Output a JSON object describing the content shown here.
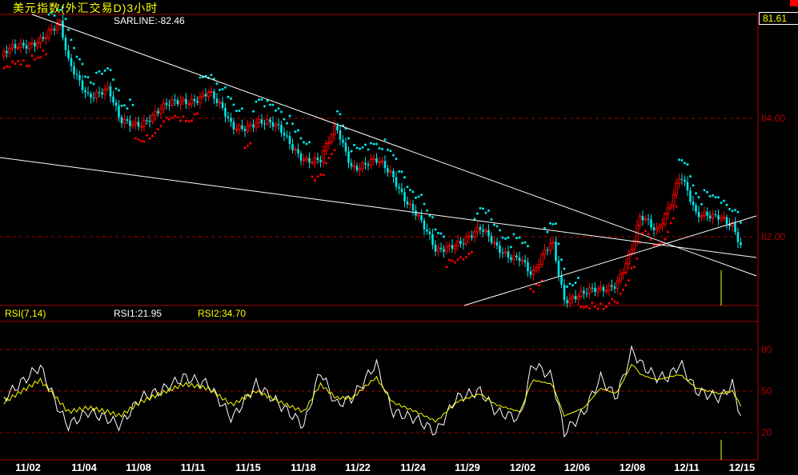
{
  "title": "美元指数(外汇交易D)3小时",
  "sar_label": "SARLINE:-82.46",
  "current_price": "81.61",
  "price_axis": [
    "84.00",
    "82.00"
  ],
  "rsi_panel": {
    "name": "RSI(7,14)",
    "rsi1": "RSI1:21.95",
    "rsi2": "RSI2:34.70",
    "axis": [
      "80",
      "50",
      "20"
    ]
  },
  "colors": {
    "up": "#ff0000",
    "down": "#00e5e5",
    "rsi1": "#ffffff",
    "rsi2": "#ffff00",
    "grid": "#b00000"
  },
  "chart_data": {
    "type": "candlestick",
    "title": "美元指数(外汇交易D)3小时",
    "x_tick_labels": [
      "11/02",
      "11/04",
      "11/08",
      "11/11",
      "11/15",
      "11/18",
      "11/22",
      "11/24",
      "11/29",
      "12/02",
      "12/06",
      "12/08",
      "12/11",
      "12/15"
    ],
    "ylim": [
      80.84,
      85.76
    ],
    "close_anchors": [
      85.05,
      85.39,
      85.53,
      84.92,
      84.45,
      84.45,
      83.9,
      83.97,
      84.11,
      84.31,
      84.45,
      83.84,
      83.97,
      83.77,
      83.36,
      83.23,
      83.84,
      83.23,
      83.23,
      83.03,
      82.42,
      81.68,
      81.95,
      82.08,
      81.81,
      81.68,
      81.27,
      81.95,
      81.0,
      81.0,
      81.07,
      81.27,
      81.81,
      82.28,
      82.08,
      82.55,
      83.09,
      82.28,
      82.42,
      82.22,
      81.61
    ],
    "rsi1": [
      45,
      68,
      35,
      25,
      35,
      30,
      25,
      45,
      50,
      60,
      55,
      30,
      55,
      40,
      25,
      65,
      40,
      45,
      70,
      35,
      30,
      20,
      45,
      50,
      35,
      30,
      70,
      60,
      20,
      35,
      60,
      45,
      80,
      70,
      60,
      60,
      70,
      50,
      45,
      55,
      22
    ],
    "rsi2": [
      42,
      58,
      42,
      35,
      38,
      35,
      32,
      42,
      48,
      55,
      52,
      40,
      50,
      42,
      35,
      55,
      45,
      45,
      60,
      42,
      35,
      28,
      42,
      48,
      40,
      35,
      58,
      55,
      32,
      38,
      52,
      48,
      70,
      62,
      58,
      60,
      62,
      52,
      48,
      50,
      35
    ],
    "rsi_ylim": [
      0,
      100
    ]
  }
}
